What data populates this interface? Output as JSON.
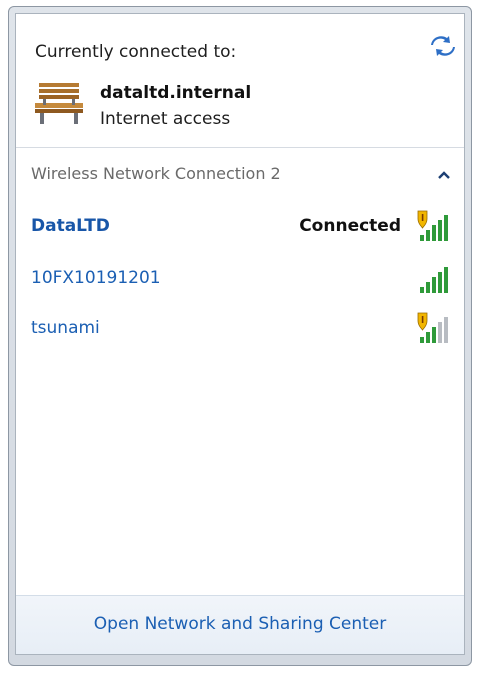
{
  "header": {
    "title": "Currently connected to:"
  },
  "current_connection": {
    "name": "dataltd.internal",
    "status": "Internet access"
  },
  "adapter": {
    "name": "Wireless Network Connection 2"
  },
  "networks": [
    {
      "name": "DataLTD",
      "state": "Connected",
      "secured": true,
      "signal_bars": 5
    },
    {
      "name": "10FX10191201",
      "state": "",
      "secured": false,
      "signal_bars": 5
    },
    {
      "name": "tsunami",
      "state": "",
      "secured": true,
      "signal_bars": 3
    }
  ],
  "footer": {
    "link": "Open Network and Sharing Center"
  },
  "icons": {
    "refresh": "refresh-icon",
    "connection": "bench-icon",
    "collapse": "chevron-up-icon",
    "signal": "wifi-signal-icon",
    "shield": "security-shield-icon"
  },
  "colors": {
    "link": "#1b5fb3",
    "signal_green": "#2f9a3a",
    "shield_yellow": "#f2b600"
  }
}
